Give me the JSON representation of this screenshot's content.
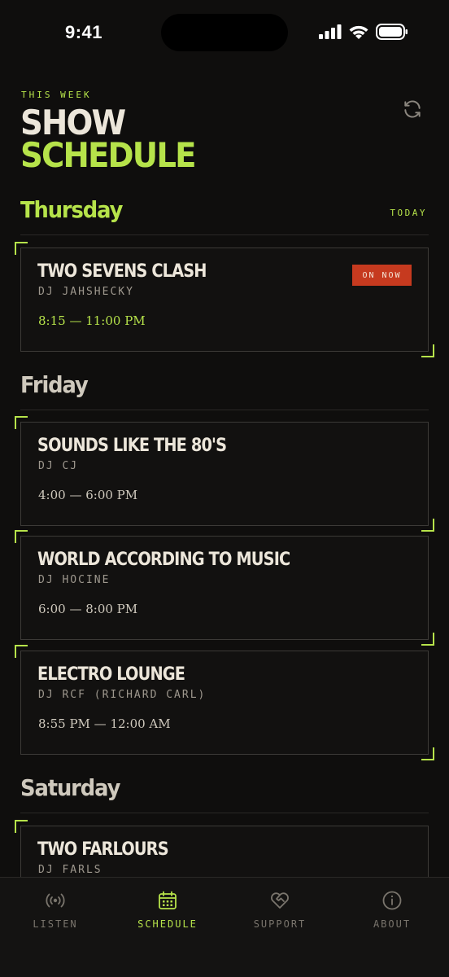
{
  "status_bar": {
    "time": "9:41"
  },
  "header": {
    "eyebrow": "THIS WEEK",
    "title_line1": "SHOW",
    "title_line2": "SCHEDULE",
    "refresh_icon": "refresh-icon"
  },
  "days": [
    {
      "name": "Thursday",
      "badge": "TODAY",
      "color": "#b6e34a",
      "shows": [
        {
          "title": "TWO SEVENS CLASH",
          "dj": "DJ JAHSHECKY",
          "time": "8:15 — 11:00 PM",
          "status": "ON NOW"
        }
      ]
    },
    {
      "name": "Friday",
      "color": "#cfc9bd",
      "shows": [
        {
          "title": "SOUNDS LIKE THE 80'S",
          "dj": "DJ CJ",
          "time": "4:00 — 6:00 PM"
        },
        {
          "title": "WORLD ACCORDING TO MUSIC",
          "dj": "DJ HOCINE",
          "time": "6:00 — 8:00 PM"
        },
        {
          "title": "ELECTRO LOUNGE",
          "dj": "DJ RCF (RICHARD CARL)",
          "time": "8:55 PM — 12:00 AM"
        }
      ]
    },
    {
      "name": "Saturday",
      "color": "#cfc9bd",
      "shows": [
        {
          "title": "TWO FARLOURS",
          "dj": "DJ FARLS",
          "time": ""
        }
      ]
    }
  ],
  "tabs": [
    {
      "label": "LISTEN",
      "icon": "broadcast-icon",
      "active": false
    },
    {
      "label": "SCHEDULE",
      "icon": "calendar-icon",
      "active": true
    },
    {
      "label": "SUPPORT",
      "icon": "heart-handshake-icon",
      "active": false
    },
    {
      "label": "ABOUT",
      "icon": "info-icon",
      "active": false
    }
  ],
  "colors": {
    "accent": "#b6e34a",
    "live": "#c63a1f",
    "background": "#0f0e0d"
  }
}
